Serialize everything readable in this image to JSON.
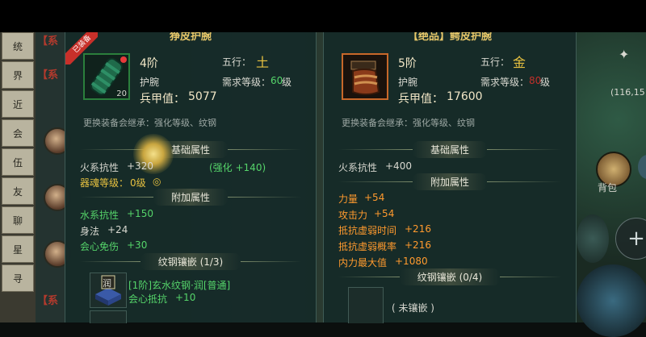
{
  "left_menu": [
    "统",
    "界",
    "近",
    "会",
    "伍",
    "友",
    "聊",
    "星",
    "寻"
  ],
  "left_tags": [
    "【系",
    "【系",
    "【系"
  ],
  "equipped_badge": "已装备",
  "item1": {
    "title": "狰皮护腕",
    "tier": "4阶",
    "element_label": "五行：",
    "element_value": "土",
    "type": "护腕",
    "level_label": "需求等级：",
    "level_value": "60",
    "level_suffix": "级",
    "power_label": "兵甲值：",
    "power_value": "5077",
    "inherit_note": "更换装备会继承：强化等级、纹钢",
    "icon_level": "20",
    "base_header": "基础属性",
    "base_stats": [
      {
        "name": "火系抗性",
        "value": "+320"
      },
      {
        "name": "器魂等级：",
        "value": "0级"
      }
    ],
    "enhance_note": "(强化 +140)",
    "extra_header": "附加属性",
    "extra_stats": [
      {
        "name": "水系抗性",
        "value": "+150"
      },
      {
        "name": "身法",
        "value": "+24"
      },
      {
        "name": "会心免伤",
        "value": "+30"
      }
    ],
    "socket_header": "纹钢镶嵌 (1/3)",
    "socket_name": "[1阶]玄水纹钢·润[普通]",
    "socket_icon_char": "润",
    "socket_stat": "会心抵抗",
    "socket_value": "+10"
  },
  "item2": {
    "title": "【绝品】鳄皮护腕",
    "tier": "5阶",
    "element_label": "五行：",
    "element_value": "金",
    "type": "护腕",
    "level_label": "需求等级：",
    "level_value": "80",
    "level_suffix": "级",
    "power_label": "兵甲值：",
    "power_value": "17600",
    "inherit_note": "更换装备会继承：强化等级、纹钢",
    "base_header": "基础属性",
    "base_stats": [
      {
        "name": "火系抗性",
        "value": "+400"
      }
    ],
    "extra_header": "附加属性",
    "extra_stats": [
      {
        "name": "力量",
        "value": "+54"
      },
      {
        "name": "攻击力",
        "value": "+54"
      },
      {
        "name": "抵抗虚弱时间",
        "value": "+216"
      },
      {
        "name": "抵抗虚弱概率",
        "value": "+216"
      },
      {
        "name": "内力最大值",
        "value": "+1080"
      }
    ],
    "socket_header": "纹钢镶嵌 (0/4)",
    "socket_empty": "( 未镶嵌 )"
  },
  "right_hud": {
    "coord": "(116,15",
    "bag_label": "背包"
  },
  "colors": {
    "panel_bg": "#162a28",
    "title_gold": "#e8c86a",
    "stat_green": "#55d46a",
    "stat_orange": "#ff9a2e",
    "level_red": "#c0302a",
    "level_green": "#55d46a"
  }
}
